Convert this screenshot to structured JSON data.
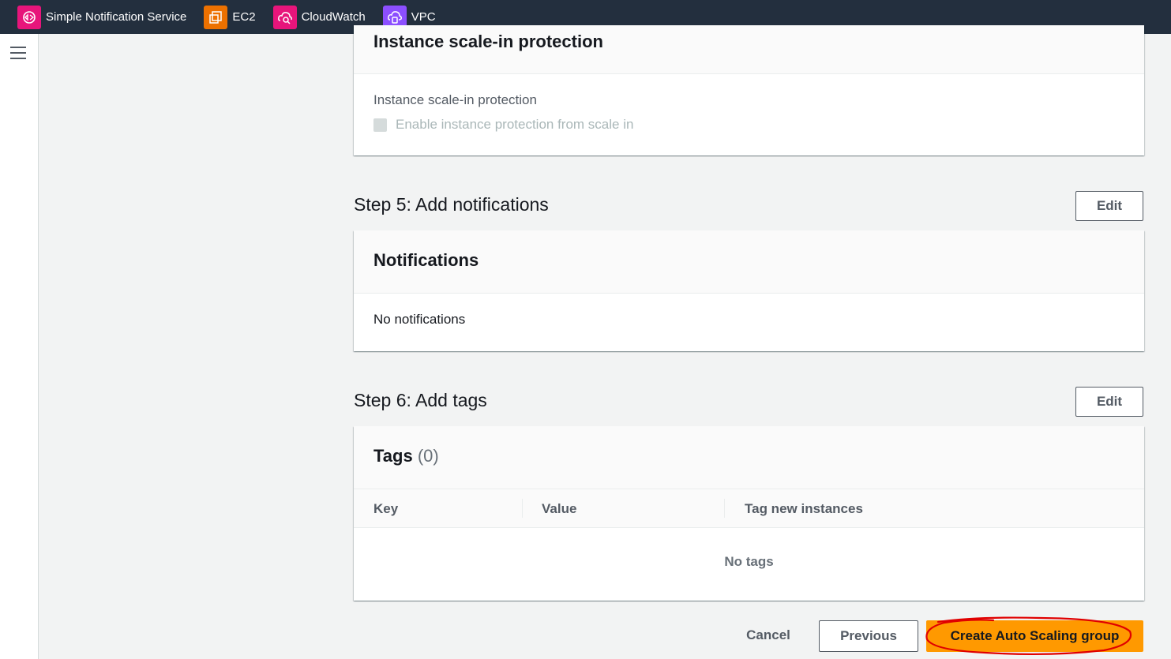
{
  "favorites": [
    {
      "label": "Simple Notification Service",
      "icon": "sns-icon",
      "color": "#e7157b"
    },
    {
      "label": "EC2",
      "icon": "ec2-icon",
      "color": "#ed7100"
    },
    {
      "label": "CloudWatch",
      "icon": "cloudwatch-icon",
      "color": "#e7157b"
    },
    {
      "label": "VPC",
      "icon": "vpc-icon",
      "color": "#8c4fff"
    }
  ],
  "scale_in": {
    "panel_title": "Instance scale-in protection",
    "field_label": "Instance scale-in protection",
    "checkbox_label": "Enable instance protection from scale in",
    "checked": false
  },
  "step5": {
    "title": "Step 5: Add notifications",
    "edit_label": "Edit",
    "panel_title": "Notifications",
    "empty_text": "No notifications"
  },
  "step6": {
    "title": "Step 6: Add tags",
    "edit_label": "Edit",
    "panel_title": "Tags",
    "count": "(0)",
    "columns": [
      "Key",
      "Value",
      "Tag new instances"
    ],
    "empty_text": "No tags"
  },
  "actions": {
    "cancel": "Cancel",
    "previous": "Previous",
    "create": "Create Auto Scaling group"
  },
  "colors": {
    "topbar": "#232f3e",
    "primary": "#ff9900",
    "annotation": "#e00000"
  }
}
